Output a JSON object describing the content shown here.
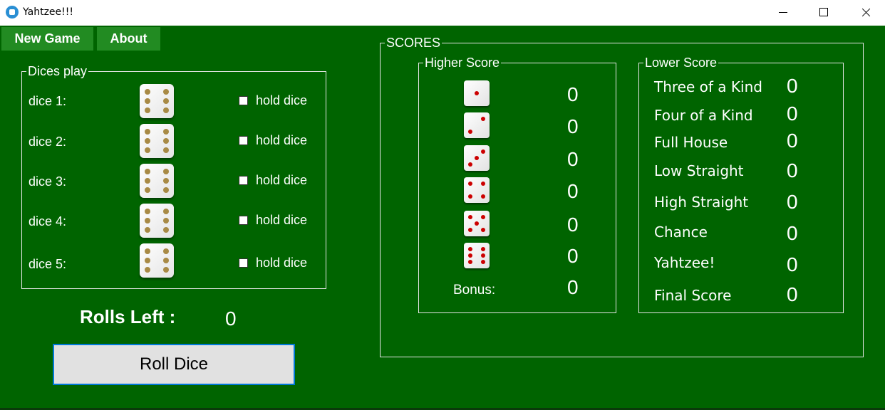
{
  "window": {
    "title": "Yahtzee!!!"
  },
  "menu": {
    "new_game": "New Game",
    "about": "About"
  },
  "dices_play": {
    "title": "Dices play",
    "dice": [
      {
        "label": "dice 1:",
        "value": 6,
        "hold_label": "hold dice",
        "held": false
      },
      {
        "label": "dice 2:",
        "value": 6,
        "hold_label": "hold dice",
        "held": false
      },
      {
        "label": "dice 3:",
        "value": 6,
        "hold_label": "hold dice",
        "held": false
      },
      {
        "label": "dice 4:",
        "value": 6,
        "hold_label": "hold dice",
        "held": false
      },
      {
        "label": "dice 5:",
        "value": 6,
        "hold_label": "hold dice",
        "held": false
      }
    ]
  },
  "rolls": {
    "label": "Rolls Left :",
    "value": "0",
    "button": "Roll Dice"
  },
  "scores": {
    "title": "SCORES",
    "higher": {
      "title": "Higher Score",
      "rows": [
        {
          "face": 1,
          "score": "0"
        },
        {
          "face": 2,
          "score": "0"
        },
        {
          "face": 3,
          "score": "0"
        },
        {
          "face": 4,
          "score": "0"
        },
        {
          "face": 5,
          "score": "0"
        },
        {
          "face": 6,
          "score": "0"
        }
      ],
      "bonus_label": "Bonus:",
      "bonus_score": "0"
    },
    "lower": {
      "title": "Lower Score",
      "rows": [
        {
          "label": "Three of a Kind",
          "score": "0"
        },
        {
          "label": "Four of a Kind",
          "score": "0"
        },
        {
          "label": "Full House",
          "score": "0"
        },
        {
          "label": "Low Straight",
          "score": "0"
        },
        {
          "label": "High Straight",
          "score": "0"
        },
        {
          "label": "Chance",
          "score": "0"
        },
        {
          "label": "Yahtzee!",
          "score": "0"
        },
        {
          "label": "Final Score",
          "score": "0"
        }
      ]
    }
  },
  "colors": {
    "background": "#006400",
    "menu_button": "#228b22",
    "big_pip": "#a88a45",
    "small_pip": "#cc0000",
    "roll_button_border": "#0078d7"
  }
}
